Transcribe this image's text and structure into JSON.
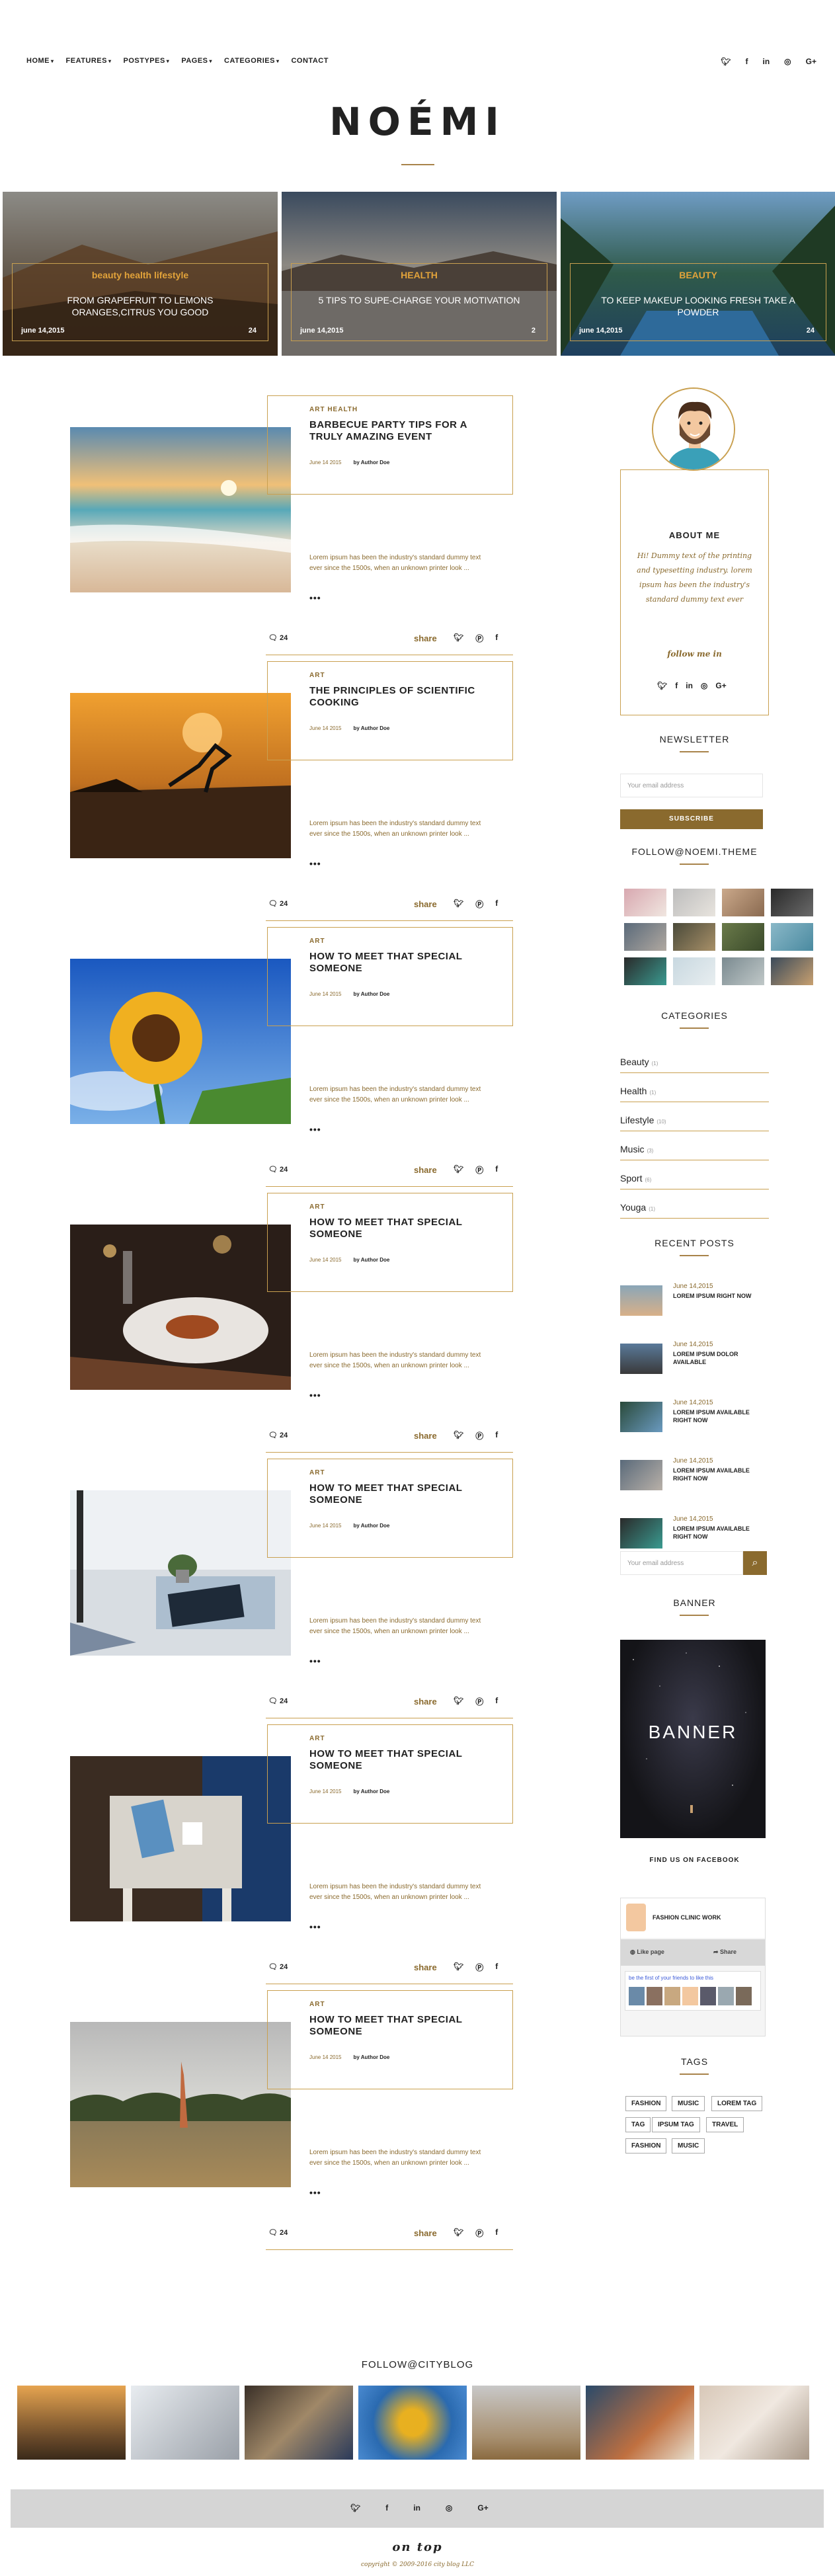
{
  "nav": {
    "items": [
      {
        "label": "HOME",
        "caret": "▾",
        "muted": false
      },
      {
        "label": "FEATURES",
        "caret": "▾",
        "muted": false
      },
      {
        "label": "POSTYPES",
        "caret": "▾",
        "muted": true
      },
      {
        "label": "PAGES",
        "caret": "▾",
        "muted": false
      },
      {
        "label": "CATEGORIES",
        "caret": "▾",
        "muted": false
      },
      {
        "label": "CONTACT",
        "caret": "",
        "muted": false
      }
    ],
    "social": [
      "twitter-icon",
      "facebook-icon",
      "linkedin-icon",
      "instagram-icon",
      "google-plus-icon"
    ]
  },
  "logo": "NOÉMI",
  "hero": [
    {
      "category": "beauty health lifestyle",
      "title": "FROM GRAPEFRUIT TO LEMONS ORANGES,CITRUS YOU GOOD",
      "date": "june 14,2015",
      "count": "24"
    },
    {
      "category": "HEALTH",
      "title": "5 TIPS TO SUPE-CHARGE YOUR MOTIVATION",
      "date": "june 14,2015",
      "count": "2"
    },
    {
      "category": "BEAUTY",
      "title": "TO KEEP MAKEUP LOOKING FRESH TAKE A POWDER",
      "date": "june 14,2015",
      "count": "24"
    }
  ],
  "posts": [
    {
      "cats": "ART    HEALTH",
      "title": "BARBECUE PARTY TIPS FOR A TRULY AMAZING EVENT",
      "date": "June 14 2015",
      "author": "by Author Doe",
      "excerpt": "Lorem ipsum has been the industry's standard dummy text ever since the 1500s, when an unknown printer look ...",
      "dots": "•••",
      "comments": "24",
      "share": "share",
      "img": "beach"
    },
    {
      "cats": "ART",
      "title": "THE PRINCIPLES OF SCIENTIFIC COOKING",
      "date": "June 14 2015",
      "author": "by Author Doe",
      "excerpt": "Lorem ipsum has been the industry's standard dummy text ever since the 1500s, when an unknown printer look ...",
      "dots": "•••",
      "comments": "24",
      "share": "share",
      "img": "dancer"
    },
    {
      "cats": "ART",
      "title": "HOW TO MEET THAT SPECIAL SOMEONE",
      "date": "June 14 2015",
      "author": "by Author Doe",
      "excerpt": "Lorem ipsum has been the industry's standard dummy text ever since the 1500s, when an unknown printer look ...",
      "dots": "•••",
      "comments": "24",
      "share": "share",
      "img": "sunflower"
    },
    {
      "cats": "ART",
      "title": "HOW TO MEET THAT SPECIAL SOMEONE",
      "date": "June 14 2015",
      "author": "by Author Doe",
      "excerpt": "Lorem ipsum has been the industry's standard dummy text ever since the 1500s, when an unknown printer look ...",
      "dots": "•••",
      "comments": "24",
      "share": "share",
      "img": "dinner"
    },
    {
      "cats": "ART",
      "title": "HOW TO MEET THAT SPECIAL SOMEONE",
      "date": "June 14 2015",
      "author": "by Author Doe",
      "excerpt": "Lorem ipsum has been the industry's standard dummy text ever since the 1500s, when an unknown printer look ...",
      "dots": "•••",
      "comments": "24",
      "share": "share",
      "img": "book"
    },
    {
      "cats": "ART",
      "title": "HOW TO MEET THAT SPECIAL SOMEONE",
      "date": "June 14 2015",
      "author": "by Author Doe",
      "excerpt": "Lorem ipsum has been the industry's standard dummy text ever since the 1500s, when an unknown printer look ...",
      "dots": "•••",
      "comments": "24",
      "share": "share",
      "img": "coffee"
    },
    {
      "cats": "ART",
      "title": "HOW TO MEET THAT SPECIAL SOMEONE",
      "date": "June 14 2015",
      "author": "by Author Doe",
      "excerpt": "Lorem ipsum has been the industry's standard dummy text ever since the 1500s, when an unknown printer look ...",
      "dots": "•••",
      "comments": "24",
      "share": "share",
      "img": "field"
    }
  ],
  "about": {
    "heading": "ABOUT ME",
    "text": "Hi! Dummy text of the printing and typesetting industry. lorem ipsum has been the industry's standard dummy text ever",
    "follow": "follow me in"
  },
  "newsletter": {
    "heading": "NEWSLETTER",
    "placeholder": "Your email address",
    "button": "SUBSCRIBE"
  },
  "instagram": {
    "heading": "FOLLOW@NOEMI.THEME"
  },
  "categories": {
    "heading": "CATEGORIES",
    "items": [
      {
        "label": "Beauty",
        "count": "(1)"
      },
      {
        "label": "Health",
        "count": "(1)"
      },
      {
        "label": "Lifestyle",
        "count": "(10)"
      },
      {
        "label": "Music",
        "count": "(3)"
      },
      {
        "label": "Sport",
        "count": "(6)"
      },
      {
        "label": "Youga",
        "count": "(1)"
      }
    ]
  },
  "recent": {
    "heading": "RECENT POSTS",
    "items": [
      {
        "date": "June 14,2015",
        "title": "LOREM IPSUM RIGHT NOW"
      },
      {
        "date": "June 14,2015",
        "title": "LOREM IPSUM DOLOR AVAILABLE"
      },
      {
        "date": "June 14,2015",
        "title": "LOREM IPSUM AVAILABLE RIGHT NOW"
      },
      {
        "date": "June 14,2015",
        "title": "LOREM IPSUM AVAILABLE RIGHT NOW"
      },
      {
        "date": "June 14,2015",
        "title": "LOREM IPSUM AVAILABLE RIGHT NOW"
      }
    ]
  },
  "search": {
    "placeholder": "Your email address"
  },
  "banner": {
    "heading": "BANNER",
    "text": "BANNER"
  },
  "facebook": {
    "heading": "FIND US ON FACEBOOK",
    "page": "FASHION CLINIC WORK",
    "like": "Like page",
    "share": "Share",
    "friends": "be the first of your friends to like this"
  },
  "tags": {
    "heading": "TAGS",
    "items": [
      "FASHION",
      "MUSIC",
      "LOREM TAG",
      "TAG",
      "IPSUM TAG",
      "TRAVEL",
      "FASHION",
      "MUSIC"
    ]
  },
  "footer": {
    "follow": "FOLLOW@CITYBLOG",
    "ontop": "on top",
    "copyright": "copyright © 2009-2016 city blog LLC"
  },
  "colors": {
    "accent": "#a8834a",
    "brown": "#8a6a2e"
  }
}
